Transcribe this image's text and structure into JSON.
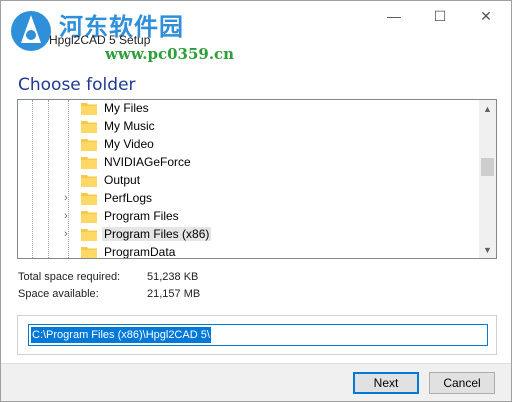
{
  "window": {
    "title": "Hpgl2CAD 5 Setup",
    "watermark_cn": "河东软件园",
    "watermark_url": "www.pc0359.cn",
    "minimize_glyph": "—",
    "maximize_glyph": "☐",
    "close_glyph": "✕"
  },
  "page": {
    "heading": "Choose folder"
  },
  "tree": {
    "items": [
      {
        "label": "My Files",
        "expandable": false,
        "selected": false
      },
      {
        "label": "My Music",
        "expandable": false,
        "selected": false
      },
      {
        "label": "My Video",
        "expandable": false,
        "selected": false
      },
      {
        "label": "NVIDIAGeForce",
        "expandable": false,
        "selected": false
      },
      {
        "label": "Output",
        "expandable": false,
        "selected": false
      },
      {
        "label": "PerfLogs",
        "expandable": true,
        "selected": false
      },
      {
        "label": "Program Files",
        "expandable": true,
        "selected": false
      },
      {
        "label": "Program Files (x86)",
        "expandable": true,
        "selected": true
      },
      {
        "label": "ProgramData",
        "expandable": false,
        "selected": false
      }
    ],
    "expander_glyph": "›",
    "scroll_up_glyph": "▲",
    "scroll_down_glyph": "▼"
  },
  "space": {
    "required_label": "Total space required:",
    "required_value": "51,238 KB",
    "available_label": "Space available:",
    "available_value": "21,157 MB"
  },
  "path": {
    "value": "C:\\Program Files (x86)\\Hpgl2CAD 5\\"
  },
  "buttons": {
    "next": "Next",
    "cancel": "Cancel"
  },
  "colors": {
    "heading": "#1f3a93",
    "accent": "#0078d7",
    "folder": "#f7c948",
    "watermark_cn": "#2f8fd8",
    "watermark_url": "#2e9e3a"
  }
}
